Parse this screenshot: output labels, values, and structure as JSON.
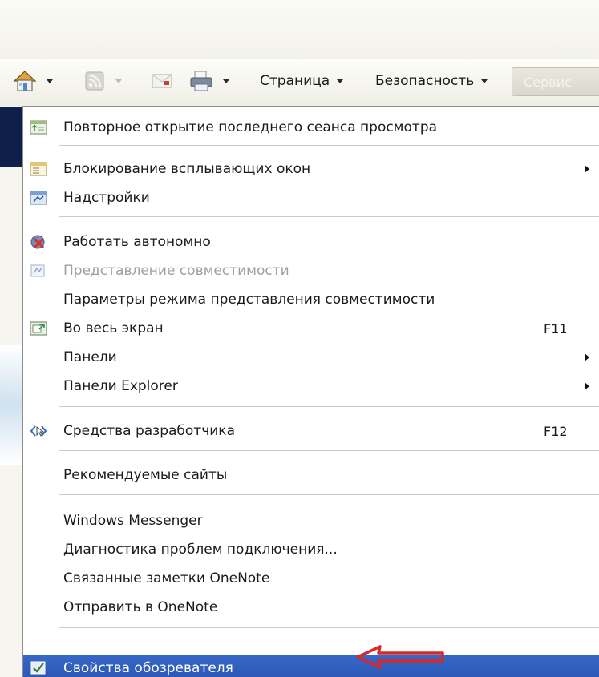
{
  "toolbar": {
    "items": [
      {
        "name": "home",
        "icon": "home-icon"
      },
      {
        "name": "feeds",
        "icon": "rss-feed-icon"
      },
      {
        "name": "mail",
        "icon": "mail-icon"
      },
      {
        "name": "print",
        "icon": "printer-icon"
      }
    ],
    "page_label": "Страница",
    "safety_label": "Безопасность",
    "service_label": "Сервис"
  },
  "menu": {
    "items": [
      {
        "label": "Повторное открытие последнего сеанса просмотра",
        "icon": "reopen-session-icon"
      },
      {
        "label": "Блокирование всплывающих окон",
        "icon": "popup-blocker-icon",
        "submenu": true
      },
      {
        "label": "Надстройки",
        "icon": "add-ons-icon"
      },
      {
        "label": "Работать автономно",
        "icon": "work-offline-icon"
      },
      {
        "label": "Представление совместимости",
        "icon": "compatibility-view-icon",
        "disabled": true
      },
      {
        "label": "Параметры режима представления совместимости"
      },
      {
        "label": "Во весь экран",
        "icon": "fullscreen-icon",
        "shortcut": "F11"
      },
      {
        "label": "Панели",
        "submenu": true
      },
      {
        "label": "Панели Explorer",
        "submenu": true
      },
      {
        "label": "Средства разработчика",
        "icon": "developer-tools-icon",
        "shortcut": "F12"
      },
      {
        "label": "Рекомендуемые сайты"
      },
      {
        "label": "Windows Messenger"
      },
      {
        "label": "Диагностика проблем подключения..."
      },
      {
        "label": "Связанные заметки OneNote"
      },
      {
        "label": "Отправить в OneNote"
      },
      {
        "label": "Свойства обозревателя",
        "icon": "internet-options-icon",
        "highlighted": true
      }
    ]
  },
  "colors": {
    "highlight": "#2f5fbe",
    "annotation_arrow": "#d42a2a",
    "disabled_text": "#a0a0a0"
  }
}
